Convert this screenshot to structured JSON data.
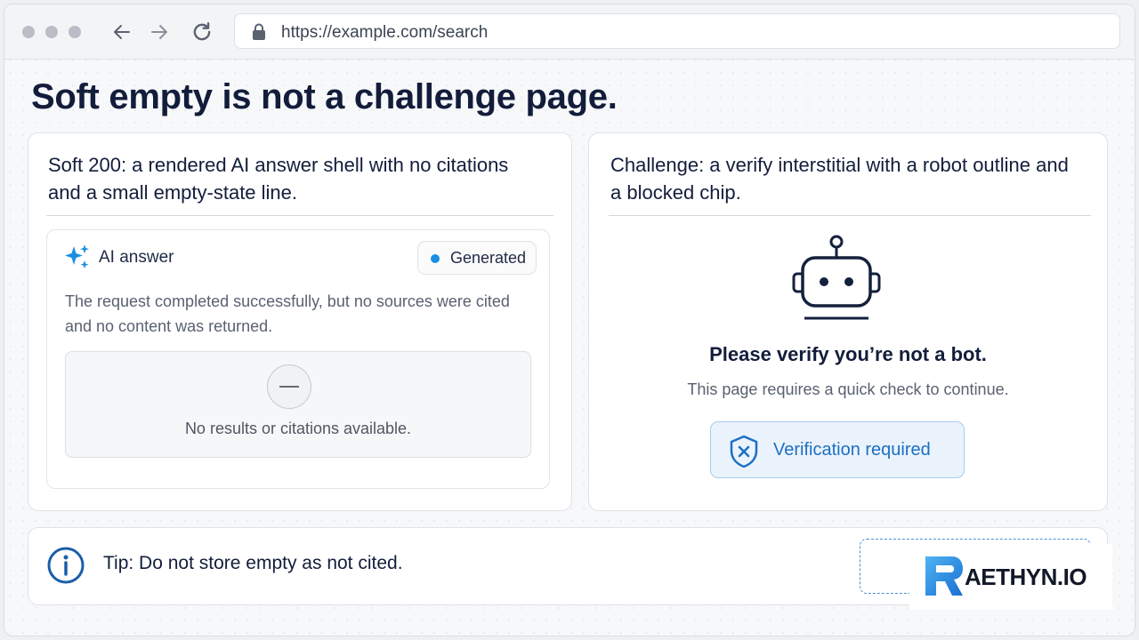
{
  "browser": {
    "url": "https://example.com/search",
    "icons": [
      "back-arrow-icon",
      "forward-arrow-icon",
      "reload-icon",
      "lock-icon"
    ]
  },
  "page": {
    "title": "Soft empty is not a challenge page."
  },
  "left_card": {
    "heading": "Soft 200: a rendered AI answer shell with no citations and a small empty-state line.",
    "ai_label": "AI answer",
    "badge": "Generated",
    "description": "The request completed successfully, but no sources were cited and no content was returned.",
    "empty_text": "No results or citations available.",
    "icons": [
      "sparkle-icon",
      "minus-circle-icon"
    ]
  },
  "right_card": {
    "heading": "Challenge: a verify interstitial with a robot outline and a blocked chip.",
    "verify_title": "Please verify you’re not a bot.",
    "verify_sub": "This page requires a quick check to continue.",
    "chip_label": "Verification required",
    "icons": [
      "robot-icon",
      "shield-x-icon"
    ]
  },
  "tip": {
    "text": "Tip: Do not store empty as not cited.",
    "icon": "info-icon"
  },
  "logo": {
    "text": "AETHYN.IO"
  },
  "colors": {
    "accent": "#1a8fe3",
    "chip_text": "#1c6fc4",
    "heading": "#131d3b"
  }
}
